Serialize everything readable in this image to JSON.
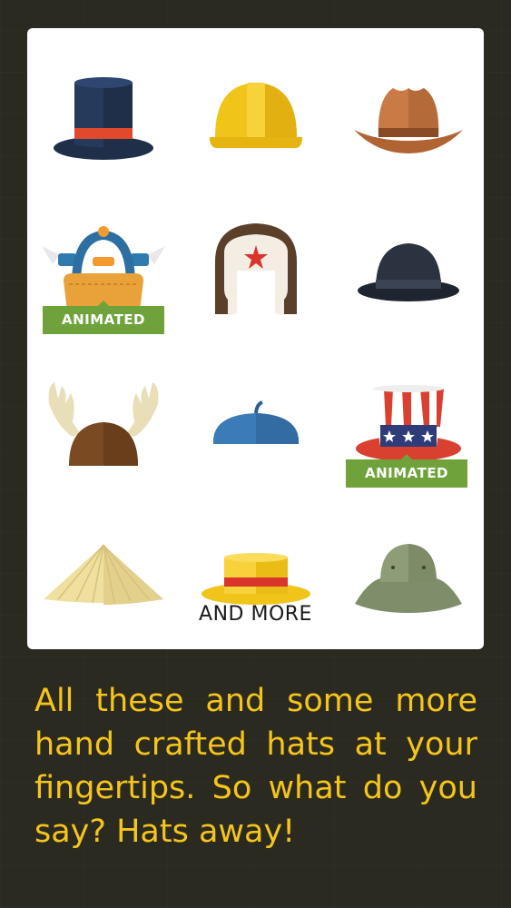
{
  "hats": [
    {
      "name": "top-hat",
      "animated": false
    },
    {
      "name": "hard-hat",
      "animated": false
    },
    {
      "name": "cowboy-hat",
      "animated": false
    },
    {
      "name": "propeller-beanie",
      "animated": true
    },
    {
      "name": "ushanka",
      "animated": false
    },
    {
      "name": "bowler-hat",
      "animated": false
    },
    {
      "name": "moose-antlers",
      "animated": false
    },
    {
      "name": "beret",
      "animated": false
    },
    {
      "name": "uncle-sam-hat",
      "animated": true
    },
    {
      "name": "conical-hat",
      "animated": false
    },
    {
      "name": "boater-hat",
      "animated": false
    },
    {
      "name": "bucket-hat",
      "animated": false
    }
  ],
  "badge_label": "ANIMATED",
  "more_label": "AND MORE",
  "caption": "All these and some more hand crafted hats at your fingertips. So what do you say? Hats away!",
  "colors": {
    "background": "#2b2a20",
    "card": "#ffffff",
    "badge": "#6fa23a",
    "caption": "#f6c51a"
  }
}
